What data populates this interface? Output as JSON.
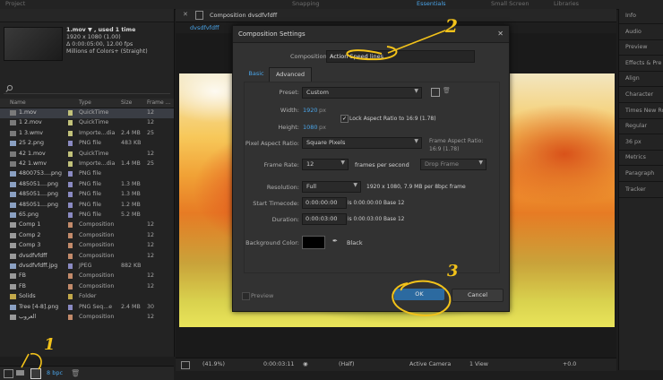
{
  "top": {
    "project_tab": "Project",
    "shapping": "Snapping",
    "essentials": "Essentials",
    "small_screen": "Small Screen",
    "libraries": "Libraries"
  },
  "project": {
    "selected_name": "1.mov ▼ , used 1 time",
    "meta": [
      "1920 x 1080 (1.00)",
      "Δ 0:00:05:00, 12.00 fps",
      "Millions of Colors+ (Straight)"
    ],
    "search_placeholder": "",
    "columns": {
      "name": "Name",
      "type": "Type",
      "size": "Size",
      "frame": "Frame ..."
    },
    "rows": [
      {
        "name": "1.mov",
        "type": "QuickTime",
        "size": "",
        "frame": "12",
        "icon": "video",
        "label": "#c2c27a",
        "selected": true
      },
      {
        "name": "1 2.mov",
        "type": "QuickTime",
        "size": "",
        "frame": "12",
        "icon": "video",
        "label": "#c2c27a"
      },
      {
        "name": "1 3.wmv",
        "type": "Importe...dia",
        "size": "2.4 MB",
        "frame": "25",
        "icon": "video",
        "label": "#c2c27a"
      },
      {
        "name": "25 2.png",
        "type": "PNG file",
        "size": "483 KB",
        "frame": "",
        "icon": "image",
        "label": "#8a8ac2"
      },
      {
        "name": "42 1.mov",
        "type": "QuickTime",
        "size": "",
        "frame": "12",
        "icon": "video",
        "label": "#c2c27a"
      },
      {
        "name": "42 1.wmv",
        "type": "Importe...dia",
        "size": "1.4 MB",
        "frame": "25",
        "icon": "video",
        "label": "#c2c27a"
      },
      {
        "name": "4800753....png",
        "type": "PNG file",
        "size": "",
        "frame": "",
        "icon": "image",
        "label": "#8a8ac2"
      },
      {
        "name": "485051....png",
        "type": "PNG file",
        "size": "1.3 MB",
        "frame": "",
        "icon": "image",
        "label": "#8a8ac2"
      },
      {
        "name": "485051....png",
        "type": "PNG file",
        "size": "1.3 MB",
        "frame": "",
        "icon": "image",
        "label": "#8a8ac2"
      },
      {
        "name": "485051....png",
        "type": "PNG file",
        "size": "1.2 MB",
        "frame": "",
        "icon": "image",
        "label": "#8a8ac2"
      },
      {
        "name": "65.png",
        "type": "PNG file",
        "size": "5.2 MB",
        "frame": "",
        "icon": "image",
        "label": "#8a8ac2"
      },
      {
        "name": "Comp 1",
        "type": "Composition",
        "size": "",
        "frame": "12",
        "icon": "comp",
        "label": "#c28a6a"
      },
      {
        "name": "Comp 2",
        "type": "Composition",
        "size": "",
        "frame": "12",
        "icon": "comp",
        "label": "#c28a6a"
      },
      {
        "name": "Comp 3",
        "type": "Composition",
        "size": "",
        "frame": "12",
        "icon": "comp",
        "label": "#c28a6a"
      },
      {
        "name": "dvsdfvfdff",
        "type": "Composition",
        "size": "",
        "frame": "12",
        "icon": "comp",
        "label": "#c28a6a"
      },
      {
        "name": "dvsdfvfdff.jpg",
        "type": "JPEG",
        "size": "882 KB",
        "frame": "",
        "icon": "image",
        "label": "#8a8ac2"
      },
      {
        "name": "FB",
        "type": "Composition",
        "size": "",
        "frame": "12",
        "icon": "comp",
        "label": "#c28a6a"
      },
      {
        "name": "FB",
        "type": "Composition",
        "size": "",
        "frame": "12",
        "icon": "comp",
        "label": "#c28a6a"
      },
      {
        "name": "Solids",
        "type": "Folder",
        "size": "",
        "frame": "",
        "icon": "folder",
        "label": "#c2a84a"
      },
      {
        "name": "Tree [4-8].png",
        "type": "PNG Seq...e",
        "size": "2.4 MB",
        "frame": "30",
        "icon": "image",
        "label": "#8a8ac2"
      },
      {
        "name": "العروب",
        "type": "Composition",
        "size": "",
        "frame": "12",
        "icon": "comp",
        "label": "#c28a6a"
      }
    ],
    "bpc": "8 bpc"
  },
  "viewer": {
    "tab_label": "Composition dvsdfvfdff",
    "sub_tab": "dvsdfvfdff",
    "zoom": "(41.9%)",
    "timecode": "0:00:03:11",
    "resolution": "(Half)",
    "camera": "Active Camera",
    "views": "1 View",
    "offset": "+0.0"
  },
  "right_panel": [
    "Info",
    "Audio",
    "Preview",
    "Effects & Pre",
    "Align",
    "Character",
    "Times New Ro",
    "Regular",
    "36 px",
    "Metrics",
    "Paragraph",
    "Tracker"
  ],
  "dialog": {
    "title": "Composition Settings",
    "name_label": "Composition Name:",
    "name_value": "Action Speed lines",
    "tabs": [
      "Basic",
      "Advanced"
    ],
    "preset_label": "Preset:",
    "preset_value": "Custom",
    "width_label": "Width:",
    "width_value": "1920",
    "height_label": "Height:",
    "height_value": "1080",
    "px": "px",
    "lock_label": "Lock Aspect Ratio to 16:9 (1.78)",
    "lock_checked": true,
    "par_label": "Pixel Aspect Ratio:",
    "par_value": "Square Pixels",
    "far_label": "Frame Aspect Ratio:",
    "far_value": "16:9 (1.78)",
    "fps_label": "Frame Rate:",
    "fps_value": "12",
    "fps_unit": "frames per second",
    "drop_frame": "Drop Frame",
    "res_label": "Resolution:",
    "res_value": "Full",
    "res_info": "1920 x 1080, 7.9 MB per 8bpc frame",
    "start_label": "Start Timecode:",
    "start_value": "0:00:00:00",
    "start_info": "is 0:00:00:00  Base 12",
    "dur_label": "Duration:",
    "dur_value": "0:00:03:00",
    "dur_info": "is 0:00:03:00  Base 12",
    "bg_label": "Background Color:",
    "bg_name": "Black",
    "bg_color": "#000000",
    "preview_label": "Preview",
    "ok_label": "OK",
    "cancel_label": "Cancel"
  },
  "annotations": {
    "one": "1",
    "two": "2",
    "three": "3"
  }
}
